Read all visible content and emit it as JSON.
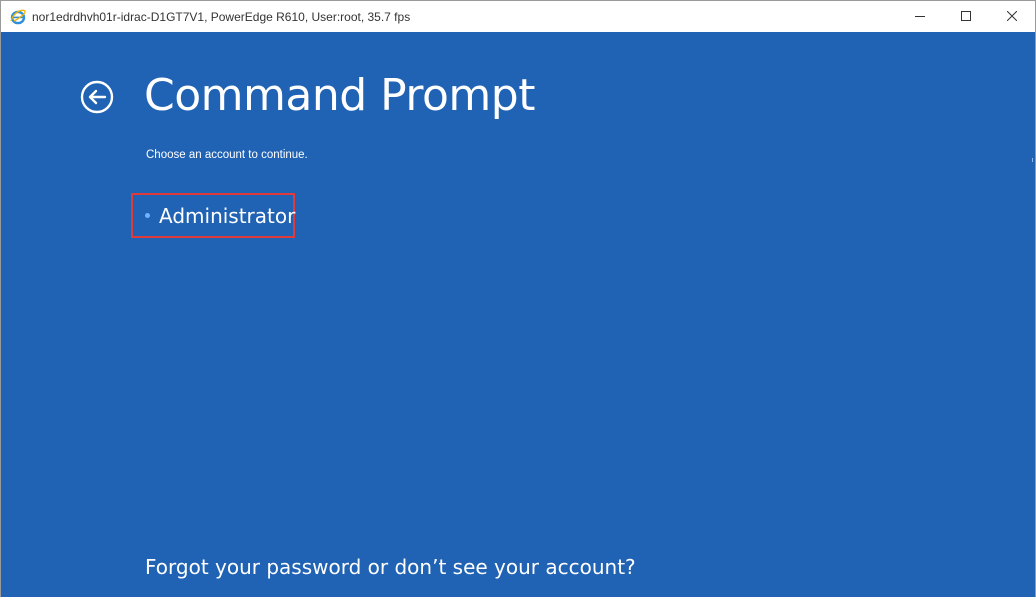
{
  "window": {
    "title": "nor1edrdhvh01r-idrac-D1GT7V1, PowerEdge R610, User:root, 35.7 fps",
    "app_icon": "internet-explorer-icon",
    "controls": [
      "minimize-icon",
      "maximize-icon",
      "close-icon"
    ]
  },
  "main": {
    "back_icon": "back-arrow-icon",
    "title": "Command Prompt",
    "subtitle": "Choose an account to continue.",
    "accounts": [
      {
        "name": "Administrator"
      }
    ],
    "forgot_link": "Forgot your password or don’t see your account?"
  },
  "colors": {
    "background": "#2062b4",
    "highlight_border": "#e13a3a",
    "account_dot": "#6fb4ff",
    "text": "#ffffff"
  }
}
